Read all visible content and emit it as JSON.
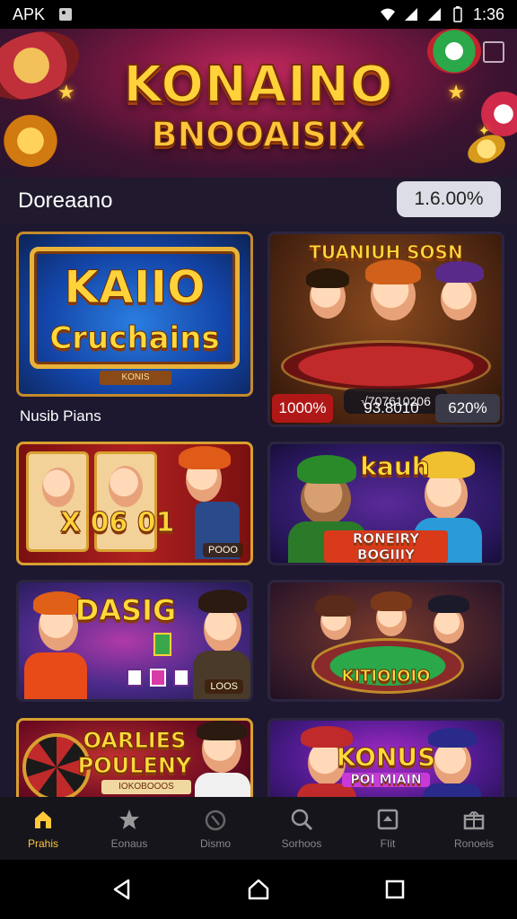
{
  "status_bar": {
    "app_label": "APK",
    "time": "1:36",
    "icons": [
      "image-icon",
      "wifi-icon",
      "signal-icon",
      "signal-icon",
      "battery-icon"
    ]
  },
  "header": {
    "logo_line1": "KONAINO",
    "logo_line2": "BNOOAISIX",
    "icons": [
      "poker-chip",
      "star",
      "window-icon"
    ]
  },
  "section": {
    "title": "Doreaano",
    "percent": "1.6.00%"
  },
  "tiles": [
    {
      "title_line1": "KAIIO",
      "title_line2": "Cruchains",
      "caption": "Nusib Pians",
      "plaque": "KONIS"
    },
    {
      "title": "TUANIUH SOSN",
      "code": "√707610206",
      "badge_left": "1000%",
      "badge_mid": "93.8010",
      "badge_right": "620%"
    },
    {
      "title": "X 06 01",
      "tag": "POOO"
    },
    {
      "title": "kauh",
      "subtitle": "RONEIRY BOGIIIY"
    },
    {
      "title": "DASIG",
      "tag": "LOOS"
    },
    {
      "title": "KITIOIOIO"
    },
    {
      "title_line1": "OARLIES",
      "title_line2": "POULENY",
      "plaque": "IOKOBOOOS"
    },
    {
      "title_line1": "KONUS",
      "title_line2": "POI MIAIN"
    }
  ],
  "bottom_nav": [
    {
      "label": "Prahis",
      "icon": "home-icon",
      "active": true
    },
    {
      "label": "Eonaus",
      "icon": "star-icon",
      "active": false
    },
    {
      "label": "Dismo",
      "icon": "power-icon",
      "active": false
    },
    {
      "label": "Sorhoos",
      "icon": "search-icon",
      "active": false
    },
    {
      "label": "FIit",
      "icon": "frame-icon",
      "active": false
    },
    {
      "label": "Ronoeis",
      "icon": "gift-icon",
      "active": false
    }
  ],
  "colors": {
    "accent": "#ffc83a",
    "background": "#1d1830",
    "nav_background": "#16151c"
  }
}
